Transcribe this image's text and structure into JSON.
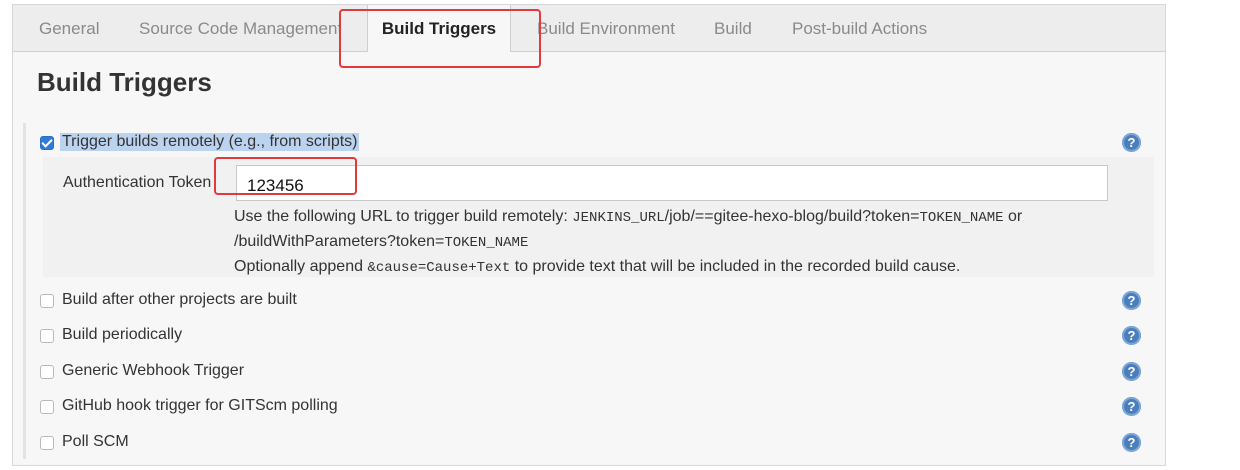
{
  "tabs": [
    "General",
    "Source Code Management",
    "Build Triggers",
    "Build Environment",
    "Build",
    "Post-build Actions"
  ],
  "section_title": "Build Triggers",
  "triggers": [
    {
      "label": "Trigger builds remotely (e.g., from scripts)",
      "checked": true
    },
    {
      "label": "Build after other projects are built",
      "checked": false
    },
    {
      "label": "Build periodically",
      "checked": false
    },
    {
      "label": "Generic Webhook Trigger",
      "checked": false
    },
    {
      "label": "GitHub hook trigger for GITScm polling",
      "checked": false
    },
    {
      "label": "Poll SCM",
      "checked": false
    }
  ],
  "auth": {
    "label": "Authentication Token",
    "value": "123456"
  },
  "help_text": {
    "line1_prefix": "Use the following URL to trigger build remotely: ",
    "line1_code": "JENKINS_URL",
    "line1_path": "/job/==gitee-hexo-blog/build?token=",
    "line1_code2": "TOKEN_NAME",
    "line1_suffix": " or",
    "line2_path": "/buildWithParameters?token=",
    "line2_code": "TOKEN_NAME",
    "line3_prefix": "Optionally append ",
    "line3_code": "&cause=Cause+Text",
    "line3_suffix": " to provide text that will be included in the recorded build cause."
  },
  "help_icon": "?",
  "colors": {
    "accent": "#2f7bd9",
    "annotation": "#e0393e",
    "selection": "#bcd3ef"
  }
}
